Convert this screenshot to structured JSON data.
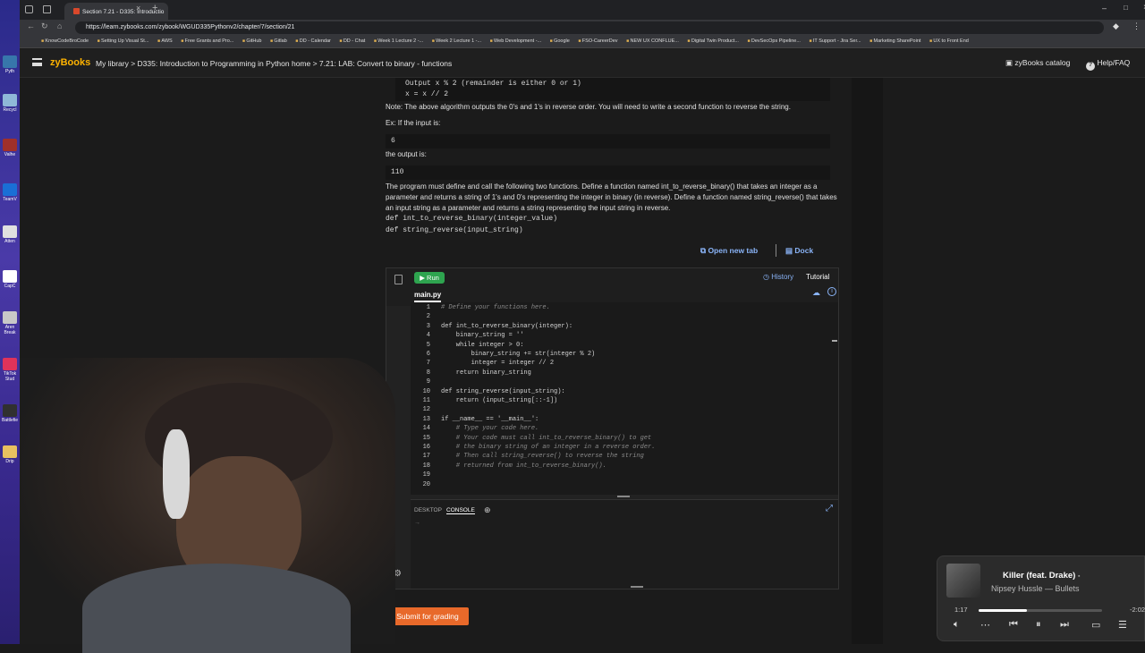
{
  "browser": {
    "tab_title": "Section 7.21 - D335: Introductio",
    "url": "https://learn.zybooks.com/zybook/WGUD335Pythonv2/chapter/7/section/21",
    "bookmarks": [
      "KnowCodeBroCode",
      "Setting Up Visual St...",
      "AWS",
      "Free Grants and Pro...",
      "GitHub",
      "Gitlab",
      "DD - Calendar",
      "DD - Chat",
      "Week 1 Lecture 2 -...",
      "Week 2 Lecture 1 -...",
      "Web Development -...",
      "Google",
      "FSO-CareerDev",
      "NEW UX CONFLUE...",
      "Digital Twin Product...",
      "DevSecOps Pipeline...",
      "IT Support - Jira Ser...",
      "Marketing SharePoint",
      "UX to Front End"
    ]
  },
  "desktop_icons": [
    "Pyth",
    "Recycl",
    "Valhe",
    "TeamV",
    "Atten",
    "CapC",
    "Aren Break",
    "TikTok Stud",
    "Battlefie",
    "Drip"
  ],
  "header": {
    "logo": "zyBooks",
    "breadcrumb": "My library  > D335: Introduction to Programming in Python home  > 7.21: LAB: Convert to binary - functions",
    "catalog": "zyBooks catalog",
    "help": "Help/FAQ"
  },
  "content": {
    "algo_line1": "Output x % 2 (remainder is either 0 or 1)",
    "algo_line2": "x = x // 2",
    "note": "Note: The above algorithm outputs the 0's and 1's in reverse order. You will need to write a second function to reverse the string.",
    "ex_label": "Ex: If the input is:",
    "ex_input": "6",
    "output_label": "the output is:",
    "ex_output": "110",
    "desc": "The program must define and call the following two functions. Define a function named int_to_reverse_binary() that takes an integer as a parameter and returns a string of 1's and 0's representing the integer in binary (in reverse). Define a function named string_reverse() that takes an input string as a parameter and returns a string representing the input string in reverse.",
    "def1": "def int_to_reverse_binary(integer_value)",
    "def2": "def string_reverse(input_string)",
    "open_new_tab": "Open new tab",
    "dock": "Dock"
  },
  "editor": {
    "run": "Run",
    "history": "History",
    "tutorial": "Tutorial",
    "filename": "main.py",
    "lines": [
      "# Define your functions here.",
      "",
      "def int_to_reverse_binary(integer):",
      "    binary_string = ''",
      "    while integer > 0:",
      "        binary_string += str(integer % 2)",
      "        integer = integer // 2",
      "    return binary_string",
      "",
      "def string_reverse(input_string):",
      "    return (input_string[::-1])",
      "",
      "if __name__ == '__main__':",
      "    # Type your code here.",
      "    # Your code must call int_to_reverse_binary() to get",
      "    # the binary string of an integer in a reverse order.",
      "    # Then call string_reverse() to reverse the string",
      "    # returned from int_to_reverse_binary().",
      "",
      ""
    ],
    "desktop_tab": "DESKTOP",
    "console_tab": "CONSOLE",
    "prompt": "→"
  },
  "submit": "Submit for grading",
  "player": {
    "song": "Killer (feat. Drake)",
    "artist": "Nipsey Hussle — Bullets",
    "elapsed": "1:17",
    "remaining": "-2:02",
    "progress": 0.39
  },
  "colors": {
    "accent": "#ffb300",
    "run": "#2ea44f",
    "submit": "#e8692a",
    "link": "#8ab4f8"
  }
}
